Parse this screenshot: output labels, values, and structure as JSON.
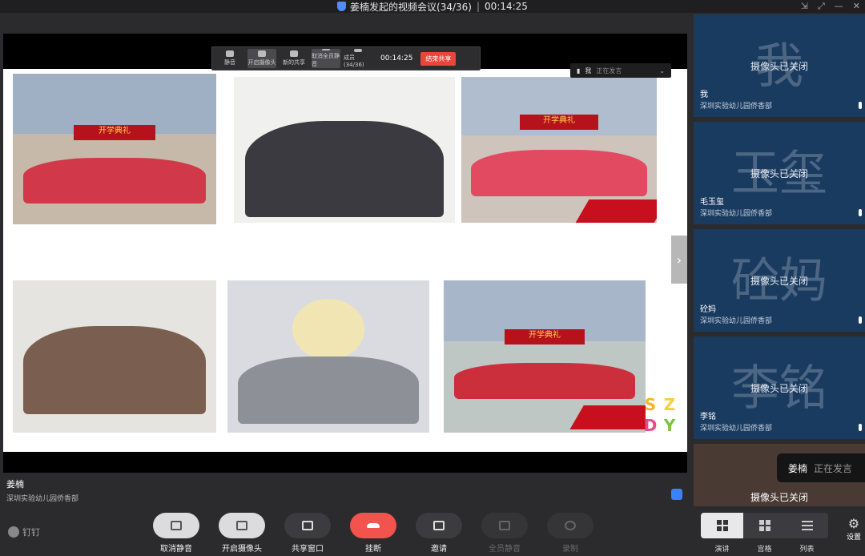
{
  "title_bar": {
    "meeting_title": "姜楠发起的视频会议(34/36)",
    "elapsed": "00:14:25",
    "controls": [
      "⇲",
      "⤢",
      "—",
      "✕"
    ]
  },
  "share_toolbar": {
    "items": [
      "静音",
      "开启摄像头",
      "新的共享",
      "取消全员静音",
      "成员(34/36)"
    ],
    "timer": "00:14:25",
    "stop_label": "结束共享"
  },
  "speaking_pill": {
    "name": "我",
    "status": "正在发言"
  },
  "slide": {
    "photos": [
      {
        "banner": "开学典礼"
      },
      {
        "banner": ""
      },
      {
        "banner": "开学典礼"
      },
      {
        "banner": ""
      },
      {
        "banner": ""
      },
      {
        "banner": "开学典礼"
      }
    ],
    "logo_letters": [
      "S",
      "Z",
      "D",
      "Y"
    ]
  },
  "presenter": {
    "name": "姜楠",
    "org": "深圳实验幼儿园侨香部"
  },
  "participants": [
    {
      "big_char": "我",
      "camera_status": "摄像头已关闭",
      "name": "我",
      "org": "深圳实验幼儿园侨香部"
    },
    {
      "big_char": "玉玺",
      "camera_status": "摄像头已关闭",
      "name": "毛玉玺",
      "org": "深圳实验幼儿园侨香部"
    },
    {
      "big_char": "砼妈",
      "camera_status": "摄像头已关闭",
      "name": "砼妈",
      "org": "深圳实验幼儿园侨香部"
    },
    {
      "big_char": "李铭",
      "camera_status": "摄像头已关闭",
      "name": "李铭",
      "org": "深圳实验幼儿园侨香部"
    },
    {
      "big_char": "",
      "camera_status": "摄像头已关闭",
      "name": "",
      "org": ""
    }
  ],
  "speaking_badge": {
    "name": "姜楠",
    "status": "正在发言"
  },
  "bottom_bar": {
    "brand": "钉钉",
    "controls": {
      "unmute": "取消静音",
      "camera": "开启摄像头",
      "share": "共享窗口",
      "hangup": "挂断",
      "invite": "邀请",
      "mute_all": "全员静音",
      "record": "录制"
    },
    "views": [
      "演讲",
      "宫格",
      "列表"
    ],
    "settings": "设置"
  }
}
